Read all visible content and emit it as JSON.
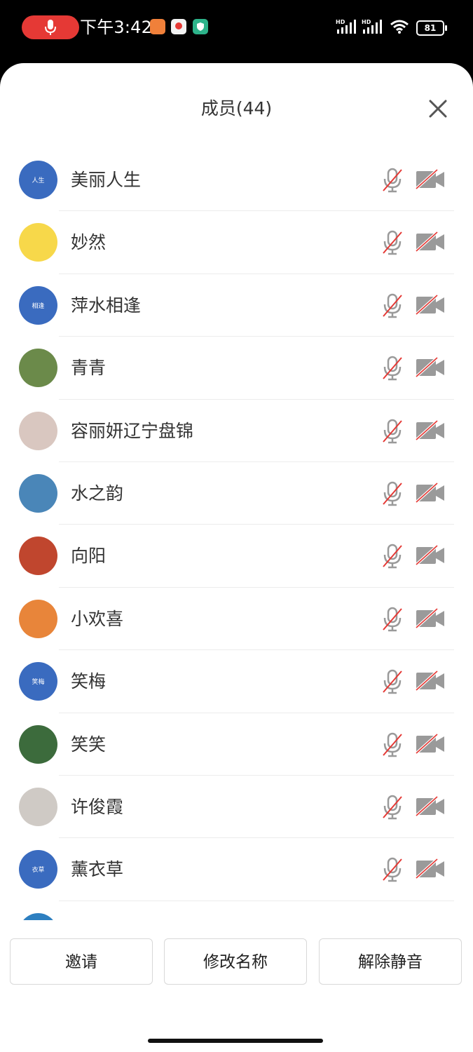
{
  "status_bar": {
    "time": "下午3:42",
    "battery": "81",
    "network_a": "HD",
    "network_b": "HD"
  },
  "sheet": {
    "title": "成员(44)"
  },
  "members": [
    {
      "name": "美丽人生",
      "avatar_text": "人生",
      "avatar_color": "#3a6bbf"
    },
    {
      "name": "妙然",
      "avatar_text": "",
      "avatar_color": "#f7d84a"
    },
    {
      "name": "萍水相逢",
      "avatar_text": "相逢",
      "avatar_color": "#3a6bbf"
    },
    {
      "name": "青青",
      "avatar_text": "",
      "avatar_color": "#6b8a4a"
    },
    {
      "name": "容丽妍辽宁盘锦",
      "avatar_text": "",
      "avatar_color": "#d9c7c0"
    },
    {
      "name": "水之韵",
      "avatar_text": "",
      "avatar_color": "#4a86b8"
    },
    {
      "name": "向阳",
      "avatar_text": "",
      "avatar_color": "#c0462e"
    },
    {
      "name": "小欢喜",
      "avatar_text": "",
      "avatar_color": "#e8853a"
    },
    {
      "name": "笑梅",
      "avatar_text": "笑梅",
      "avatar_color": "#3a6bbf"
    },
    {
      "name": "笑笑",
      "avatar_text": "",
      "avatar_color": "#3c6b3c"
    },
    {
      "name": "许俊霞",
      "avatar_text": "",
      "avatar_color": "#cfcac5"
    },
    {
      "name": "薰衣草",
      "avatar_text": "衣草",
      "avatar_color": "#3a6bbf"
    },
    {
      "name": "",
      "avatar_text": "",
      "avatar_color": "#2d7fc0"
    }
  ],
  "buttons": {
    "invite": "邀请",
    "rename": "修改名称",
    "unmute": "解除静音"
  },
  "colors": {
    "accent_blue": "#3a6bbf",
    "muted_icon": "#9a9a9a",
    "muted_slash": "#e53935",
    "record_pill": "#e53935"
  }
}
